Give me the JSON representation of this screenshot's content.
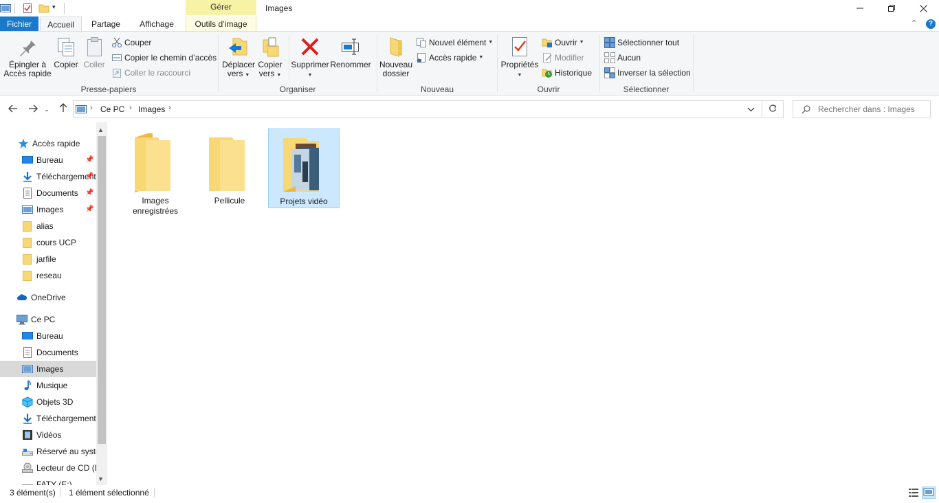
{
  "window": {
    "title": "Images",
    "context_tab_group": "Gérer"
  },
  "tabs": [
    {
      "label": "Fichier"
    },
    {
      "label": "Accueil"
    },
    {
      "label": "Partage"
    },
    {
      "label": "Affichage"
    },
    {
      "label": "Outils d’image"
    }
  ],
  "ribbon": {
    "clipboard": {
      "label": "Presse-papiers",
      "pin_l1": "Épingler à",
      "pin_l2": "Accès rapide",
      "copy": "Copier",
      "paste": "Coller",
      "cut": "Couper",
      "copy_path": "Copier le chemin d’accès",
      "paste_shortcut": "Coller le raccourci"
    },
    "organize": {
      "label": "Organiser",
      "move_l1": "Déplacer",
      "move_l2": "vers",
      "copyto_l1": "Copier",
      "copyto_l2": "vers",
      "delete": "Supprimer",
      "rename": "Renommer"
    },
    "new": {
      "label": "Nouveau",
      "folder_l1": "Nouveau",
      "folder_l2": "dossier",
      "new_item": "Nouvel élément",
      "quick_access": "Accès rapide"
    },
    "open": {
      "label": "Ouvrir",
      "properties": "Propriétés",
      "open": "Ouvrir",
      "edit": "Modifier",
      "history": "Historique"
    },
    "select": {
      "label": "Sélectionner",
      "select_all": "Sélectionner tout",
      "none": "Aucun",
      "invert": "Inverser la sélection"
    }
  },
  "address": {
    "crumbs": [
      "Ce PC",
      "Images"
    ],
    "search_placeholder": "Rechercher dans : Images"
  },
  "navpane": {
    "quick_access": "Accès rapide",
    "quick_items": [
      {
        "label": "Bureau"
      },
      {
        "label": "Téléchargements"
      },
      {
        "label": "Documents"
      },
      {
        "label": "Images"
      },
      {
        "label": "alias"
      },
      {
        "label": "cours UCP"
      },
      {
        "label": "jarfile"
      },
      {
        "label": "reseau"
      }
    ],
    "onedrive": "OneDrive",
    "this_pc": "Ce PC",
    "pc_items": [
      {
        "label": "Bureau"
      },
      {
        "label": "Documents"
      },
      {
        "label": "Images"
      },
      {
        "label": "Musique"
      },
      {
        "label": "Objets 3D"
      },
      {
        "label": "Téléchargements"
      },
      {
        "label": "Vidéos"
      },
      {
        "label": "Réservé au système"
      },
      {
        "label": "Lecteur de CD (D:)"
      },
      {
        "label": "FATY (E:)"
      }
    ]
  },
  "content": {
    "items": [
      {
        "l1": "Images",
        "l2": "enregistrées"
      },
      {
        "l1": "Pellicule",
        "l2": ""
      },
      {
        "l1": "Projets vidéo",
        "l2": ""
      }
    ]
  },
  "status": {
    "count": "3 élément(s)",
    "selected": "1 élément sélectionné"
  },
  "colors": {
    "accent": "#1979ca",
    "folder": "#f8d775",
    "selection": "#cce8ff",
    "context_tab": "#f6f3a6"
  }
}
